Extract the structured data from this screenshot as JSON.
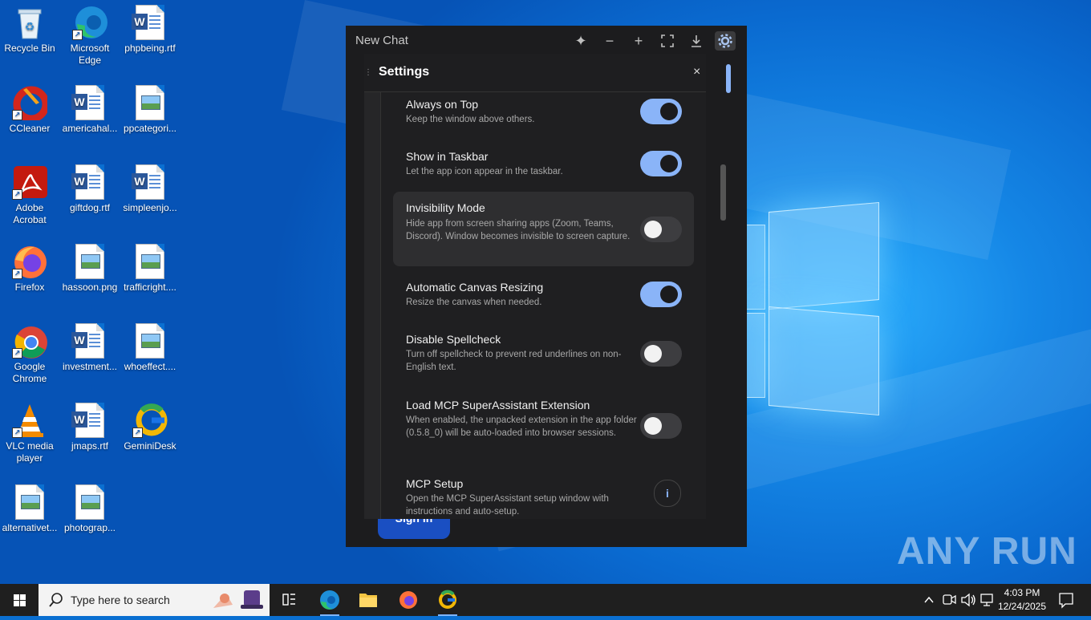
{
  "desktop": {
    "icons": [
      {
        "label": "Recycle Bin"
      },
      {
        "label": "Microsoft Edge"
      },
      {
        "label": "phpbeing.rtf"
      },
      {
        "label": "CCleaner"
      },
      {
        "label": "americahal..."
      },
      {
        "label": "ppcategori..."
      },
      {
        "label": "Adobe Acrobat"
      },
      {
        "label": "giftdog.rtf"
      },
      {
        "label": "simpleenjo..."
      },
      {
        "label": "Firefox"
      },
      {
        "label": "hassoon.png"
      },
      {
        "label": "trafficright...."
      },
      {
        "label": "Google Chrome"
      },
      {
        "label": "investment..."
      },
      {
        "label": "whoeffect...."
      },
      {
        "label": "VLC media player"
      },
      {
        "label": "jmaps.rtf"
      },
      {
        "label": "GeminiDesk"
      },
      {
        "label": "alternativet..."
      },
      {
        "label": "photograp..."
      }
    ]
  },
  "app": {
    "title": "New Chat",
    "toolbar_icons": [
      "sparkle-icon",
      "minimize-icon",
      "plus-icon",
      "fullscreen-icon",
      "download-icon",
      "gear-icon"
    ],
    "signin_label": "Sign in"
  },
  "settings": {
    "title": "Settings",
    "close_glyph": "×",
    "items": [
      {
        "title": "Always on Top",
        "desc": "Keep the window above others.",
        "enabled": true
      },
      {
        "title": "Show in Taskbar",
        "desc": "Let the app icon appear in the taskbar.",
        "enabled": true
      },
      {
        "title": "Invisibility Mode",
        "desc": "Hide app from screen sharing apps (Zoom, Teams, Discord). Window becomes invisible to screen capture.",
        "enabled": false
      },
      {
        "title": "Automatic Canvas Resizing",
        "desc": "Resize the canvas when needed.",
        "enabled": true
      },
      {
        "title": "Disable Spellcheck",
        "desc": "Turn off spellcheck to prevent red underlines on non-English text.",
        "enabled": false
      },
      {
        "title": "Load MCP SuperAssistant Extension",
        "desc": "When enabled, the unpacked extension in the app folder (0.5.8_0) will be auto-loaded into browser sessions.",
        "enabled": false
      },
      {
        "title": "MCP Setup",
        "desc": "Open the MCP SuperAssistant setup window with instructions and auto-setup.",
        "button": "i"
      }
    ]
  },
  "watermark": "ANY RUN",
  "taskbar": {
    "search_placeholder": "Type here to search",
    "time": "4:03 PM",
    "date": "12/24/2025"
  },
  "colors": {
    "accent": "#8ab4f8",
    "toggle_knob_on": "#1b1b1d",
    "app_bg": "#1c1c1e",
    "taskbar_bg": "#1f1f1f"
  }
}
